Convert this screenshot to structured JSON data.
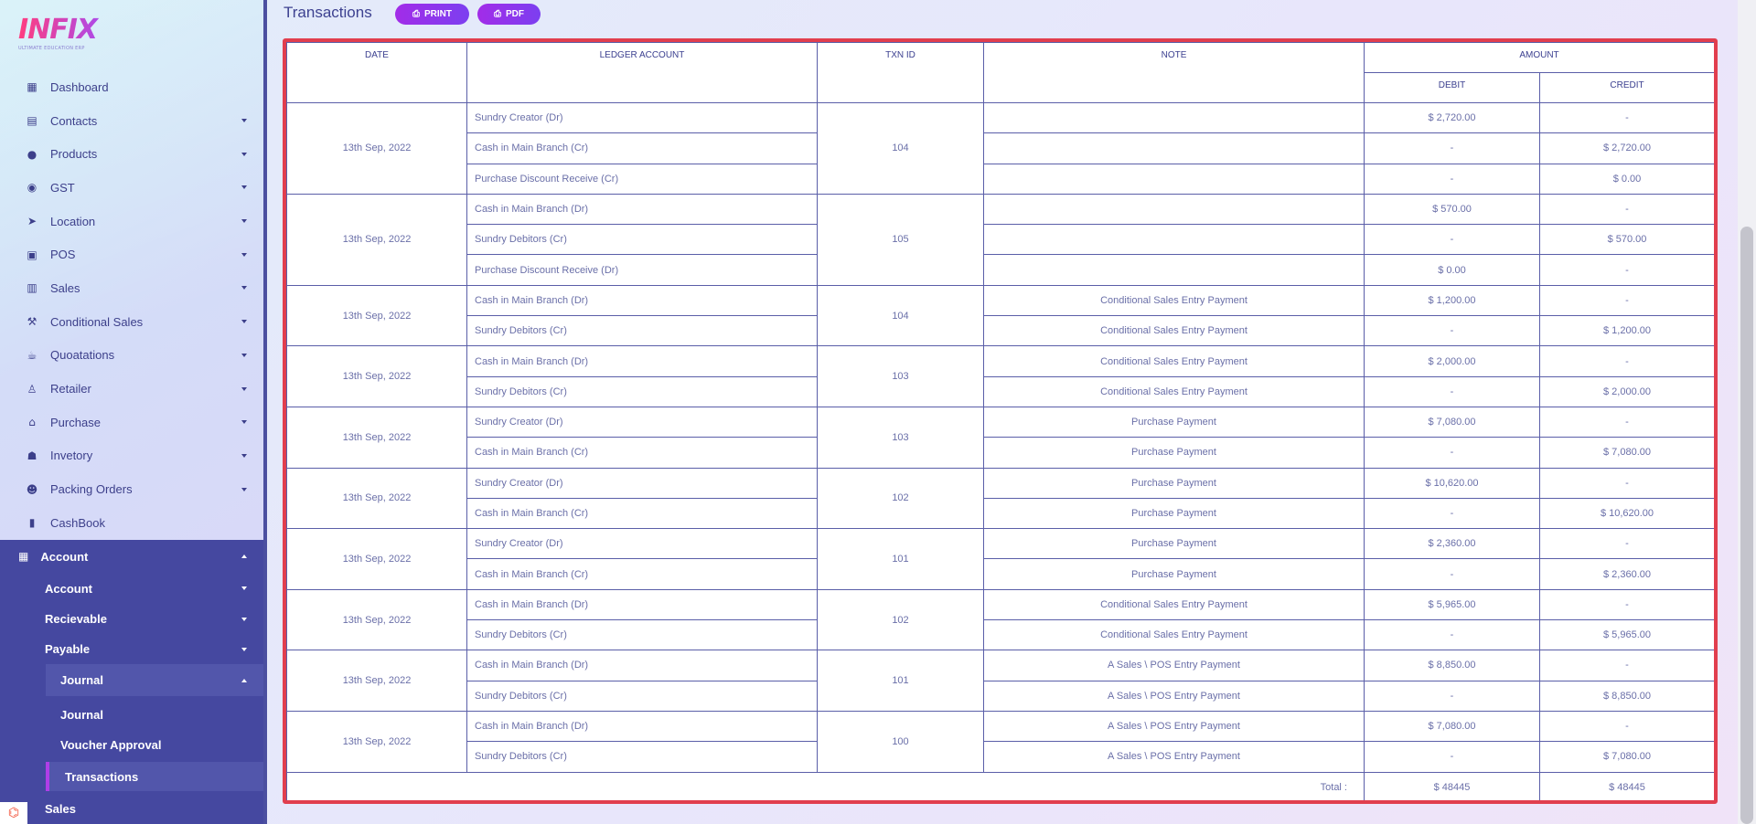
{
  "app": {
    "logo": "INFIX",
    "logo_sub": "ULTIMATE EDUCATION ERP"
  },
  "sidebar": {
    "items": [
      {
        "label": "Dashboard",
        "icon": "grid-icon"
      },
      {
        "label": "Contacts",
        "icon": "contacts-icon"
      },
      {
        "label": "Products",
        "icon": "products-icon"
      },
      {
        "label": "GST",
        "icon": "gst-icon"
      },
      {
        "label": "Location",
        "icon": "location-icon"
      },
      {
        "label": "POS",
        "icon": "pos-icon"
      },
      {
        "label": "Sales",
        "icon": "store-icon"
      },
      {
        "label": "Conditional Sales",
        "icon": "gavel-icon"
      },
      {
        "label": "Quoatations",
        "icon": "mug-icon"
      },
      {
        "label": "Retailer",
        "icon": "retailer-icon"
      },
      {
        "label": "Purchase",
        "icon": "shop-icon"
      },
      {
        "label": "Invetory",
        "icon": "bank-icon"
      },
      {
        "label": "Packing Orders",
        "icon": "users-icon"
      },
      {
        "label": "CashBook",
        "icon": "book-icon"
      }
    ],
    "account": {
      "label": "Account",
      "children": [
        {
          "label": "Account"
        },
        {
          "label": "Recievable"
        },
        {
          "label": "Payable"
        },
        {
          "label": "Journal"
        }
      ],
      "journal_children": [
        {
          "label": "Journal"
        },
        {
          "label": "Voucher Approval"
        },
        {
          "label": "Transactions"
        }
      ],
      "next_section": "Sales"
    }
  },
  "page": {
    "title": "Transactions",
    "print_label": "PRINT",
    "pdf_label": "PDF"
  },
  "table": {
    "headers": {
      "date": "DATE",
      "ledger": "LEDGER ACCOUNT",
      "txn": "TXN ID",
      "note": "NOTE",
      "amount": "AMOUNT",
      "debit": "DEBIT",
      "credit": "CREDIT"
    },
    "groups": [
      {
        "date": "13th Sep, 2022",
        "txn": "104",
        "rows": [
          {
            "ledger": "Sundry Creator (Dr)",
            "note": "",
            "debit": "$ 2,720.00",
            "credit": "-"
          },
          {
            "ledger": "Cash in Main Branch (Cr)",
            "note": "",
            "debit": "-",
            "credit": "$ 2,720.00"
          },
          {
            "ledger": "Purchase Discount Receive (Cr)",
            "note": "",
            "debit": "-",
            "credit": "$ 0.00"
          }
        ]
      },
      {
        "date": "13th Sep, 2022",
        "txn": "105",
        "rows": [
          {
            "ledger": "Cash in Main Branch (Dr)",
            "note": "",
            "debit": "$ 570.00",
            "credit": "-"
          },
          {
            "ledger": "Sundry Debitors (Cr)",
            "note": "",
            "debit": "-",
            "credit": "$ 570.00"
          },
          {
            "ledger": "Purchase Discount Receive (Dr)",
            "note": "",
            "debit": "$ 0.00",
            "credit": "-"
          }
        ]
      },
      {
        "date": "13th Sep, 2022",
        "txn": "104",
        "rows": [
          {
            "ledger": "Cash in Main Branch (Dr)",
            "note": "Conditional Sales Entry Payment",
            "debit": "$ 1,200.00",
            "credit": "-"
          },
          {
            "ledger": "Sundry Debitors (Cr)",
            "note": "Conditional Sales Entry Payment",
            "debit": "-",
            "credit": "$ 1,200.00"
          }
        ]
      },
      {
        "date": "13th Sep, 2022",
        "txn": "103",
        "rows": [
          {
            "ledger": "Cash in Main Branch (Dr)",
            "note": "Conditional Sales Entry Payment",
            "debit": "$ 2,000.00",
            "credit": "-"
          },
          {
            "ledger": "Sundry Debitors (Cr)",
            "note": "Conditional Sales Entry Payment",
            "debit": "-",
            "credit": "$ 2,000.00"
          }
        ]
      },
      {
        "date": "13th Sep, 2022",
        "txn": "103",
        "rows": [
          {
            "ledger": "Sundry Creator (Dr)",
            "note": "Purchase Payment",
            "debit": "$ 7,080.00",
            "credit": "-"
          },
          {
            "ledger": "Cash in Main Branch (Cr)",
            "note": "Purchase Payment",
            "debit": "-",
            "credit": "$ 7,080.00"
          }
        ]
      },
      {
        "date": "13th Sep, 2022",
        "txn": "102",
        "rows": [
          {
            "ledger": "Sundry Creator (Dr)",
            "note": "Purchase Payment",
            "debit": "$ 10,620.00",
            "credit": "-"
          },
          {
            "ledger": "Cash in Main Branch (Cr)",
            "note": "Purchase Payment",
            "debit": "-",
            "credit": "$ 10,620.00"
          }
        ]
      },
      {
        "date": "13th Sep, 2022",
        "txn": "101",
        "rows": [
          {
            "ledger": "Sundry Creator (Dr)",
            "note": "Purchase Payment",
            "debit": "$ 2,360.00",
            "credit": "-"
          },
          {
            "ledger": "Cash in Main Branch (Cr)",
            "note": "Purchase Payment",
            "debit": "-",
            "credit": "$ 2,360.00"
          }
        ]
      },
      {
        "date": "13th Sep, 2022",
        "txn": "102",
        "rows": [
          {
            "ledger": "Cash in Main Branch (Dr)",
            "note": "Conditional Sales Entry Payment",
            "debit": "$ 5,965.00",
            "credit": "-"
          },
          {
            "ledger": "Sundry Debitors (Cr)",
            "note": "Conditional Sales Entry Payment",
            "debit": "-",
            "credit": "$ 5,965.00"
          }
        ]
      },
      {
        "date": "13th Sep, 2022",
        "txn": "101",
        "rows": [
          {
            "ledger": "Cash in Main Branch (Dr)",
            "note": "A Sales \\ POS Entry Payment",
            "debit": "$ 8,850.00",
            "credit": "-"
          },
          {
            "ledger": "Sundry Debitors (Cr)",
            "note": "A Sales \\ POS Entry Payment",
            "debit": "-",
            "credit": "$ 8,850.00"
          }
        ]
      },
      {
        "date": "13th Sep, 2022",
        "txn": "100",
        "rows": [
          {
            "ledger": "Cash in Main Branch (Dr)",
            "note": "A Sales \\ POS Entry Payment",
            "debit": "$ 7,080.00",
            "credit": "-"
          },
          {
            "ledger": "Sundry Debitors (Cr)",
            "note": "A Sales \\ POS Entry Payment",
            "debit": "-",
            "credit": "$ 7,080.00"
          }
        ]
      }
    ],
    "total_label": "Total :",
    "total_debit": "$ 48445",
    "total_credit": "$ 48445"
  },
  "colors": {
    "accent": "#a22ce8",
    "table_border": "#e13e4e",
    "sidebar_dark": "#4548a0"
  }
}
